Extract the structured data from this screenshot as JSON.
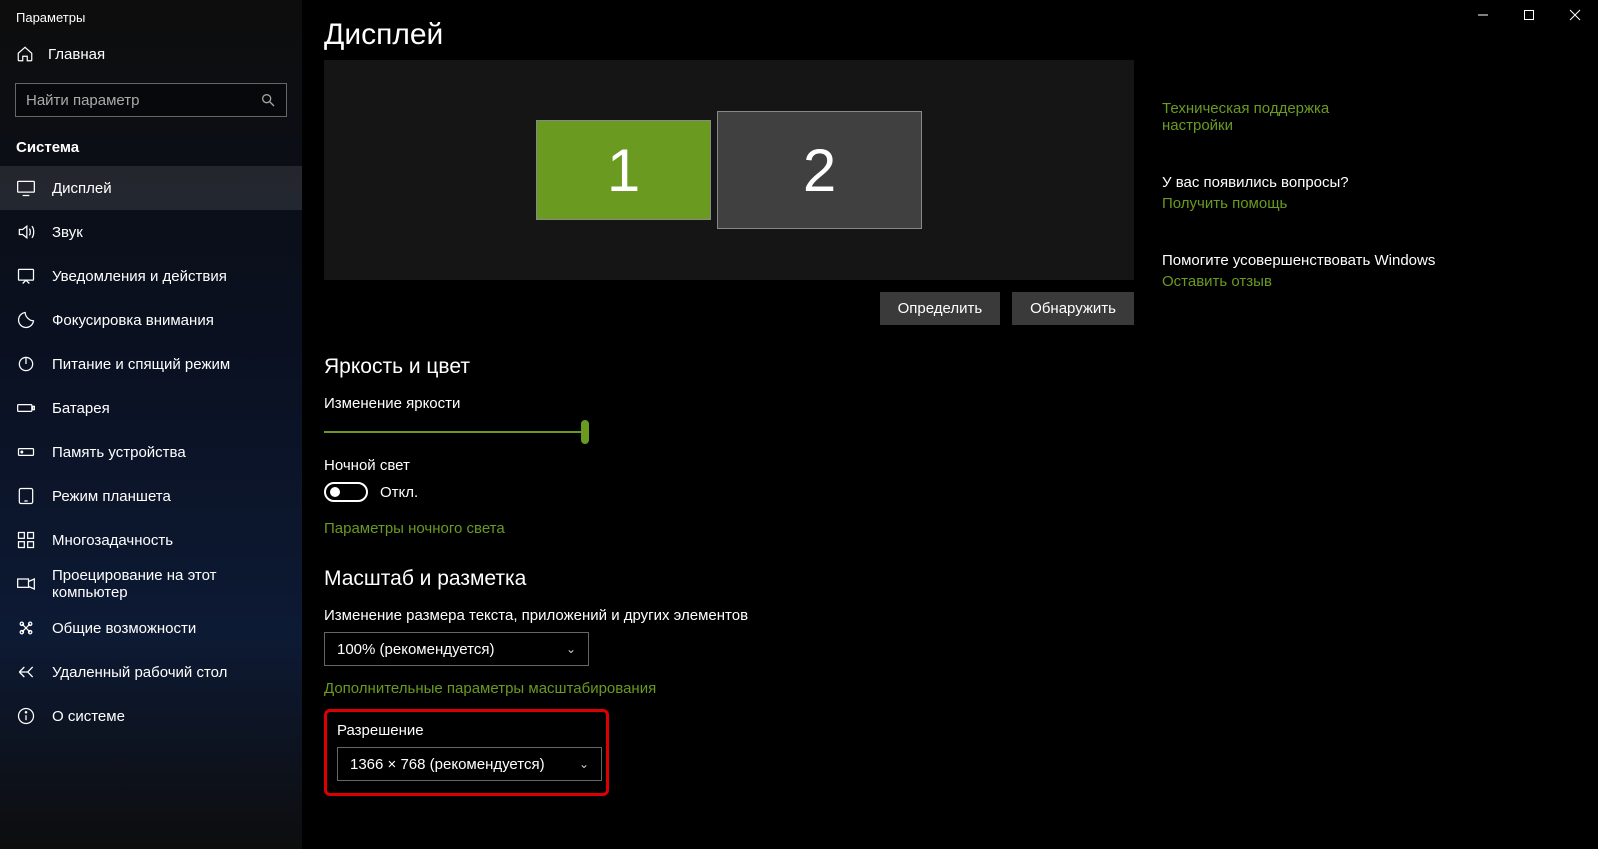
{
  "window": {
    "title": "Параметры"
  },
  "sidebar": {
    "home": "Главная",
    "search_placeholder": "Найти параметр",
    "category": "Система",
    "items": [
      {
        "label": "Дисплей"
      },
      {
        "label": "Звук"
      },
      {
        "label": "Уведомления и действия"
      },
      {
        "label": "Фокусировка внимания"
      },
      {
        "label": "Питание и спящий режим"
      },
      {
        "label": "Батарея"
      },
      {
        "label": "Память устройства"
      },
      {
        "label": "Режим планшета"
      },
      {
        "label": "Многозадачность"
      },
      {
        "label": "Проецирование на этот компьютер"
      },
      {
        "label": "Общие возможности"
      },
      {
        "label": "Удаленный рабочий стол"
      },
      {
        "label": "О системе"
      }
    ]
  },
  "page": {
    "title": "Дисплей",
    "monitors": {
      "m1": "1",
      "m2": "2"
    },
    "buttons": {
      "identify": "Определить",
      "detect": "Обнаружить"
    },
    "brightness": {
      "heading": "Яркость и цвет",
      "label": "Изменение яркости",
      "night_label": "Ночной свет",
      "night_state": "Откл.",
      "night_link": "Параметры ночного света"
    },
    "scale": {
      "heading": "Масштаб и разметка",
      "label": "Изменение размера текста, приложений и других элементов",
      "scale_value": "100% (рекомендуется)",
      "advanced_link": "Дополнительные параметры масштабирования",
      "resolution_label": "Разрешение",
      "resolution_value": "1366 × 768 (рекомендуется)"
    }
  },
  "right": {
    "block0_line1": "Техническая поддержка",
    "block0_line2": "настройки",
    "block1_q": "У вас появились вопросы?",
    "block1_a": "Получить помощь",
    "block2_q": "Помогите усовершенствовать Windows",
    "block2_a": "Оставить отзыв"
  }
}
